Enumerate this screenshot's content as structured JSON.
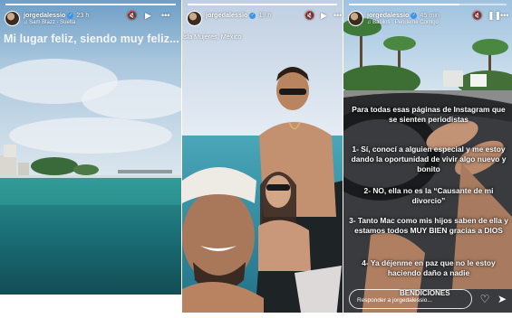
{
  "stories": [
    {
      "username": "jorgedalessio",
      "time": "23 h",
      "music": "Sam Blazz · Suelta",
      "caption": "Mi lugar feliz, siendo muy feliz...",
      "progress": 1.0
    },
    {
      "username": "jorgedalessio",
      "time": "19 h",
      "location": "Isla Mujeres, México",
      "progress": 1.0
    },
    {
      "username": "jorgedalessio",
      "time": "45 min",
      "music": "Bacilos · Pendeme Contigo",
      "progress": 0.7,
      "text": {
        "intro": "Para todas esas páginas de Instagram que se sienten periodistas",
        "p1": "1- Sí, conocí a alguien especial y me estoy dando la oportunidad de vivir algo nuevo y bonito",
        "p2": "2- NO, ella no es la “Causante de mi divorcio”",
        "p3": "3- Tanto Mac como mis hijos saben de ella y estamos todos MUY BIEN gracias a DIOS",
        "p4": "4- Ya déjenme en paz que no le estoy haciendo daño a nadie",
        "sticker": "BENDICIONES"
      },
      "reply_placeholder": "Responder a jorgedalessio..."
    }
  ],
  "icons": {
    "mute": "speaker-muted-icon",
    "play": "play-icon",
    "pause": "pause-icon",
    "more": "more-icon",
    "heart": "heart-icon",
    "send": "send-icon"
  }
}
